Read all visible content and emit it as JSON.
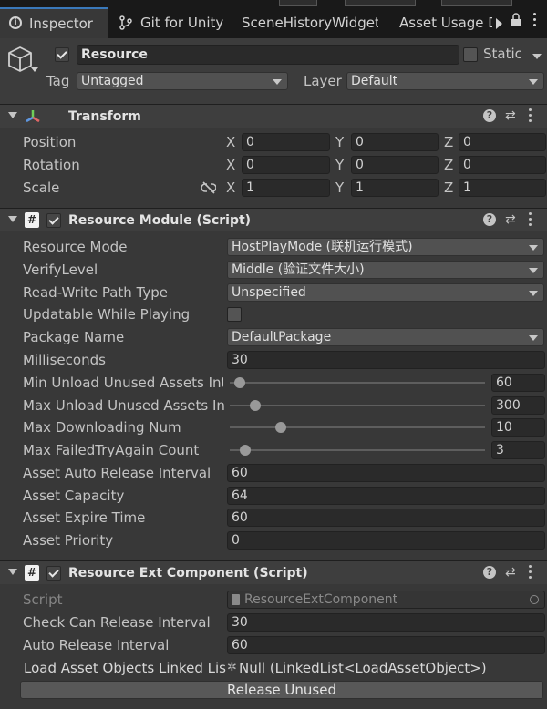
{
  "tabs": [
    {
      "label": "Inspector",
      "icon": "info-icon",
      "active": true
    },
    {
      "label": "Git for Unity",
      "icon": "git-icon"
    },
    {
      "label": "SceneHistoryWidget"
    },
    {
      "label": "Asset Usage D"
    }
  ],
  "header": {
    "object_name": "Resource",
    "static_label": "Static",
    "tag_label": "Tag",
    "tag_value": "Untagged",
    "layer_label": "Layer",
    "layer_value": "Default"
  },
  "transform": {
    "title": "Transform",
    "rows": [
      {
        "label": "Position",
        "x": "0",
        "y": "0",
        "z": "0"
      },
      {
        "label": "Rotation",
        "x": "0",
        "y": "0",
        "z": "0"
      },
      {
        "label": "Scale",
        "x": "1",
        "y": "1",
        "z": "1"
      }
    ],
    "axes": [
      "X",
      "Y",
      "Z"
    ]
  },
  "resource_module": {
    "title": "Resource Module (Script)",
    "resource_mode_label": "Resource Mode",
    "resource_mode_value": "HostPlayMode (联机运行模式)",
    "verify_level_label": "VerifyLevel",
    "verify_level_value": "Middle (验证文件大小)",
    "rw_path_label": "Read-Write Path Type",
    "rw_path_value": "Unspecified",
    "updatable_label": "Updatable While Playing",
    "package_name_label": "Package Name",
    "package_name_value": "DefaultPackage",
    "milliseconds_label": "Milliseconds",
    "milliseconds_value": "30",
    "sliders": [
      {
        "label": "Min Unload Unused Assets Inte",
        "value": "60",
        "fraction": 0.04
      },
      {
        "label": "Max Unload Unused Assets Inte",
        "value": "300",
        "fraction": 0.1
      },
      {
        "label": "Max Downloading Num",
        "value": "10",
        "fraction": 0.2
      },
      {
        "label": "Max FailedTryAgain Count",
        "value": "3",
        "fraction": 0.06
      }
    ],
    "auto_release_label": "Asset Auto Release Interval",
    "auto_release_value": "60",
    "capacity_label": "Asset Capacity",
    "capacity_value": "64",
    "expire_label": "Asset Expire Time",
    "expire_value": "60",
    "priority_label": "Asset Priority",
    "priority_value": "0"
  },
  "ext_component": {
    "title": "Resource Ext Component (Script)",
    "script_label": "Script",
    "script_value": "ResourceExtComponent",
    "check_release_label": "Check Can Release Interval",
    "check_release_value": "30",
    "auto_release_label": "Auto Release Interval",
    "auto_release_value": "60",
    "linked_list_label": "Load Asset Objects Linked List",
    "linked_list_value": "Null (LinkedList<LoadAssetObject>)",
    "release_button": "Release Unused"
  },
  "colors": {
    "background": "#383838",
    "tabbar": "#191919",
    "accent": "#3a79bb",
    "field": "#2a2a2a"
  }
}
